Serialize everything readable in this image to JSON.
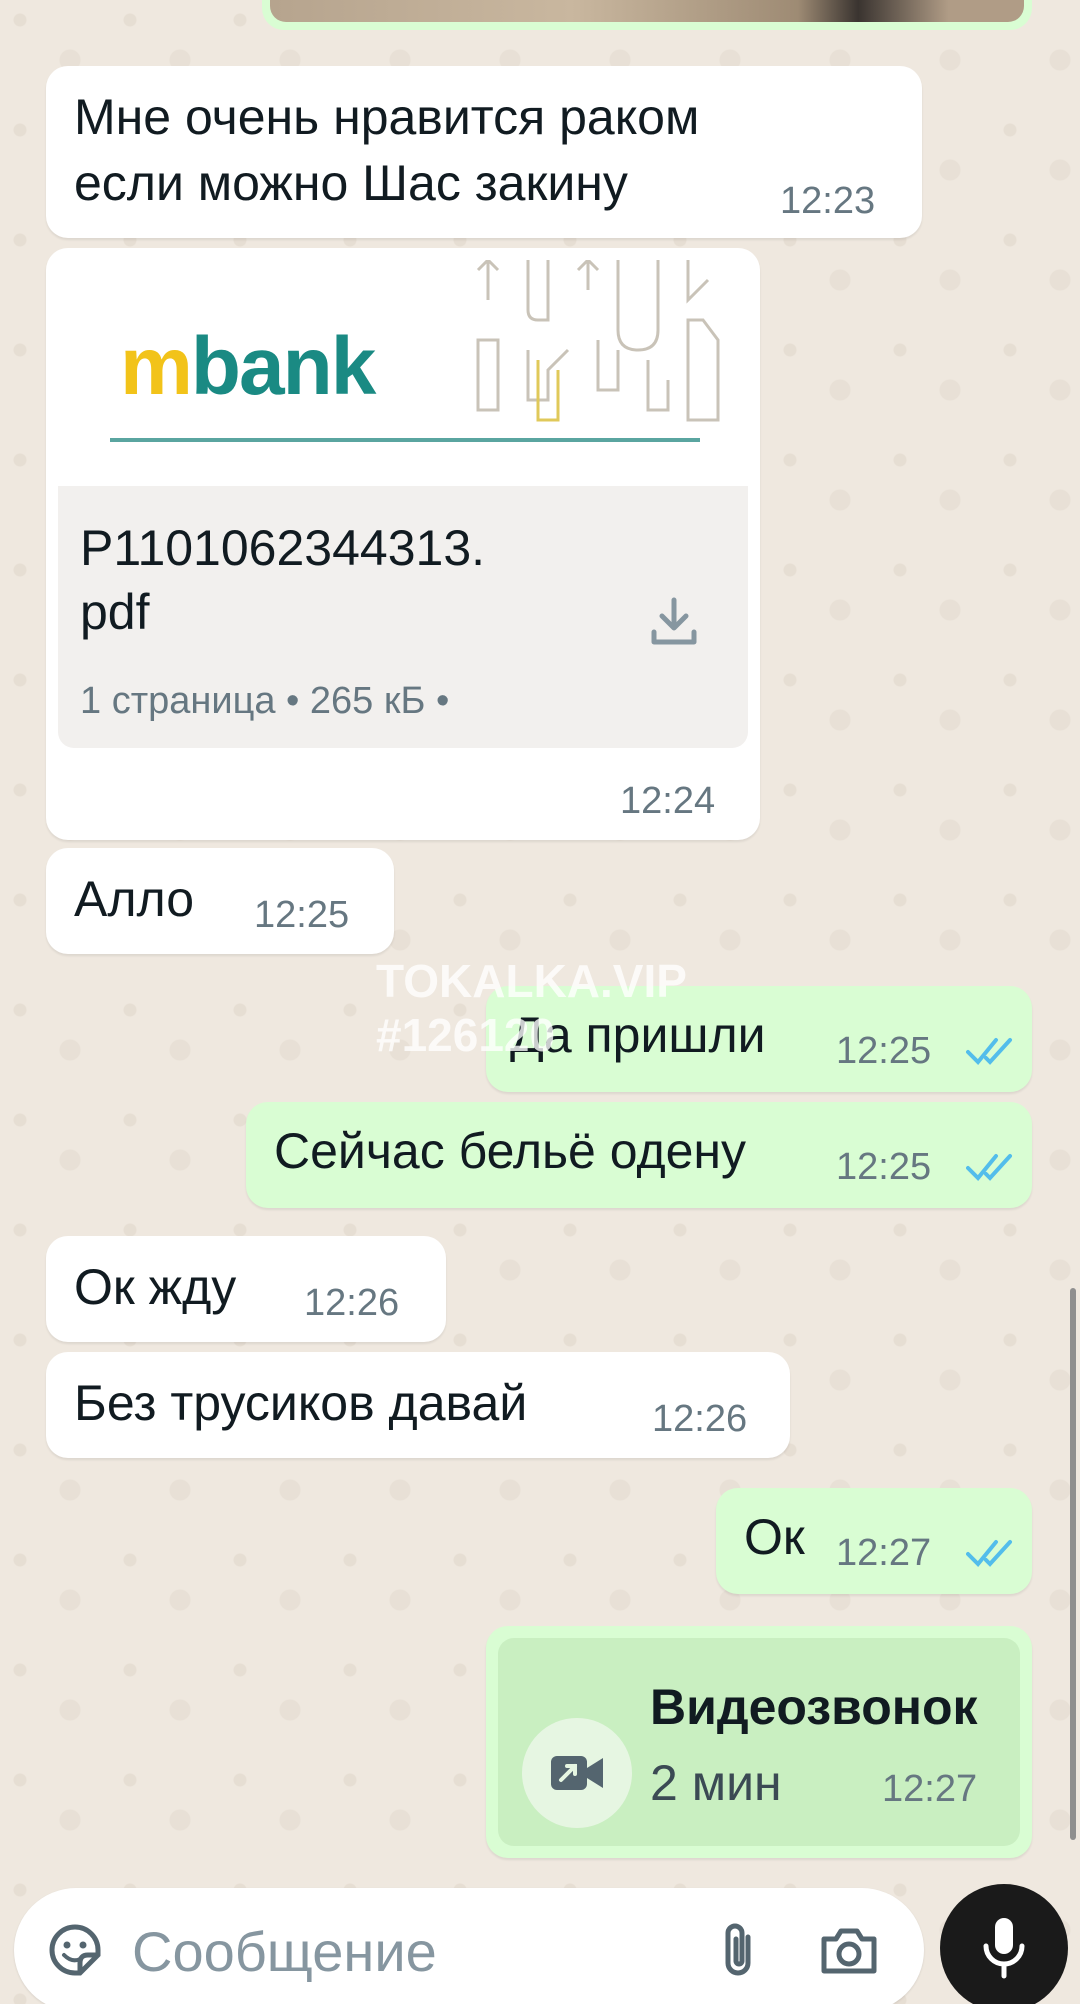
{
  "messages": [
    {
      "id": "m1",
      "direction": "incoming",
      "text_line1": "Мне очень нравится раком",
      "text_line2": "если можно Шас закину",
      "time": "12:23"
    },
    {
      "id": "m2",
      "direction": "incoming",
      "type": "document",
      "brand": "mbank",
      "file_name_line1": "P1101062344313.",
      "file_name_line2": "pdf",
      "meta": "1 страница • 265 кБ •",
      "time": "12:24"
    },
    {
      "id": "m3",
      "direction": "incoming",
      "text": "Алло",
      "time": "12:25"
    },
    {
      "id": "m4",
      "direction": "outgoing",
      "text": "Да пришли",
      "time": "12:25",
      "status": "read"
    },
    {
      "id": "m5",
      "direction": "outgoing",
      "text": "Сейчас бельё одену",
      "time": "12:25",
      "status": "read"
    },
    {
      "id": "m6",
      "direction": "incoming",
      "text": "Ок жду",
      "time": "12:26"
    },
    {
      "id": "m7",
      "direction": "incoming",
      "text": "Без трусиков давай",
      "time": "12:26"
    },
    {
      "id": "m8",
      "direction": "outgoing",
      "text": "Ок",
      "time": "12:27",
      "status": "read"
    },
    {
      "id": "m9",
      "direction": "outgoing",
      "type": "call",
      "title": "Видеозвонок",
      "duration": "2 мин",
      "time": "12:27"
    }
  ],
  "watermark": {
    "line1": "TOKALKA.VIP",
    "line2": "#126120"
  },
  "composer": {
    "placeholder": "Сообщение",
    "icons": [
      "sticker-icon",
      "paperclip-icon",
      "camera-icon",
      "microphone-icon"
    ]
  },
  "colors": {
    "incoming_bubble": "#ffffff",
    "outgoing_bubble": "#d9fdd3",
    "read_ticks": "#53bdeb",
    "wallpaper": "#efe8df",
    "mbank_green": "#1a8a83",
    "mbank_yellow": "#f2c319"
  }
}
